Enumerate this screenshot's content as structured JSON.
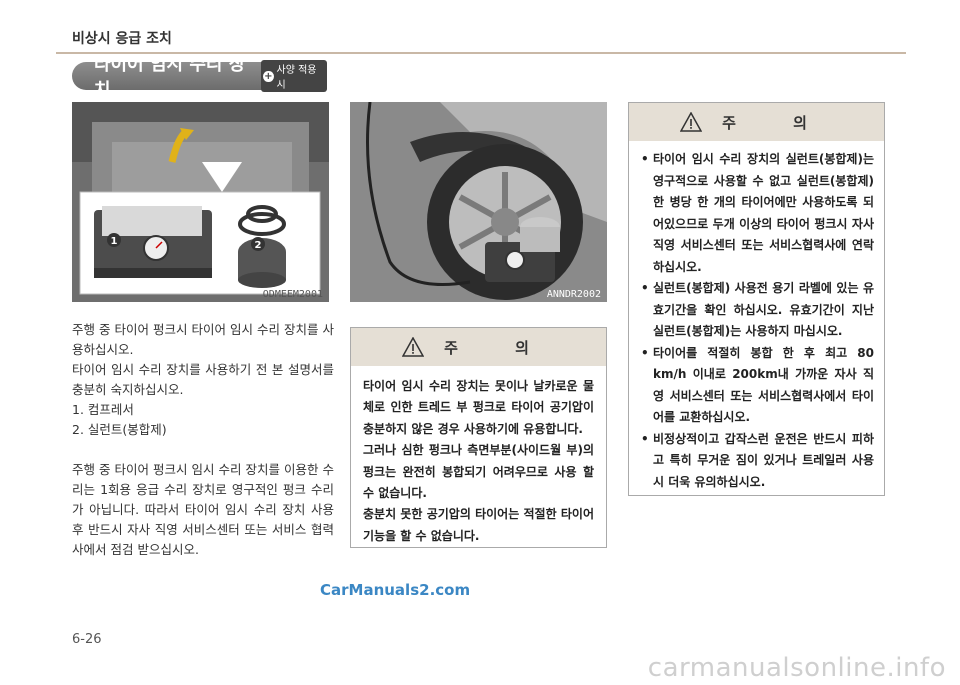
{
  "header": {
    "section": "비상시 응급 조치"
  },
  "title": {
    "text": "타이어 임시 수리 장치",
    "badge": "사양 적용시"
  },
  "images": {
    "left_code": "ODMEEM2001",
    "right_code": "ANNDR2002",
    "callout_1": "1",
    "callout_2": "2"
  },
  "body": {
    "p1": "주행 중 타이어 펑크시 타이어 임시 수리 장치를 사용하십시오.",
    "p2": "타이어 임시 수리 장치를 사용하기 전 본 설명서를 충분히 숙지하십시오.",
    "list": [
      "1.  컴프레서",
      "2.  실런트(봉합제)"
    ],
    "p3": "주행 중 타이어 펑크시 임시 수리 장치를 이용한 수리는 1회용 응급 수리 장치로 영구적인 펑크 수리가 아닙니다. 따라서 타이어 임시 수리 장치 사용 후 반드시 자사 직영 서비스센터 또는 서비스 협력사에서 점검 받으십시오."
  },
  "caution_middle": {
    "title": "주 의",
    "text1": "타이어 임시 수리 장치는 못이나 날카로운 물체로 인한 트레드 부 펑크로 타이어 공기압이 충분하지 않은 경우 사용하기에 유용합니다.",
    "text2": "그러나 심한 펑크나 측면부분(사이드월 부)의 펑크는 완전히 봉합되기 어려우므로 사용 할 수 없습니다.",
    "text3": "충분치 못한 공기압의 타이어는 적절한 타이어 기능을 할 수 없습니다."
  },
  "caution_right": {
    "title": "주 의",
    "items": [
      "타이어 임시 수리 장치의 실런트(봉합제)는 영구적으로 사용할 수 없고 실런트(봉합제) 한 병당 한 개의 타이어에만 사용하도록 되어있으므로 두개 이상의 타이어 펑크시 자사 직영 서비스센터 또는 서비스협력사에 연락하십시오.",
      "실런트(봉합제) 사용전 용기 라벨에 있는 유효기간을 확인 하십시오. 유효기간이 지난 실런트(봉합제)는 사용하지 마십시오.",
      "타이어를 적절히 봉합 한 후 최고 80 km/h 이내로 200km내 가까운 자사 직영 서비스센터 또는 서비스협력사에서 타이어를 교환하십시오.",
      "비정상적이고 갑작스런 운전은 반드시 피하고 특히 무거운 짐이 있거나 트레일러 사용 시 더욱 유의하십시오."
    ]
  },
  "footer": {
    "page": "6-26",
    "watermark": "CarManuals2.com",
    "site": "carmanualsonline.info"
  },
  "colors": {
    "header_rule": "#c9b8a6",
    "caution_header_bg": "#e5dfd5",
    "title_pill": "#7a7a7a",
    "watermark": "#3b87c4"
  }
}
